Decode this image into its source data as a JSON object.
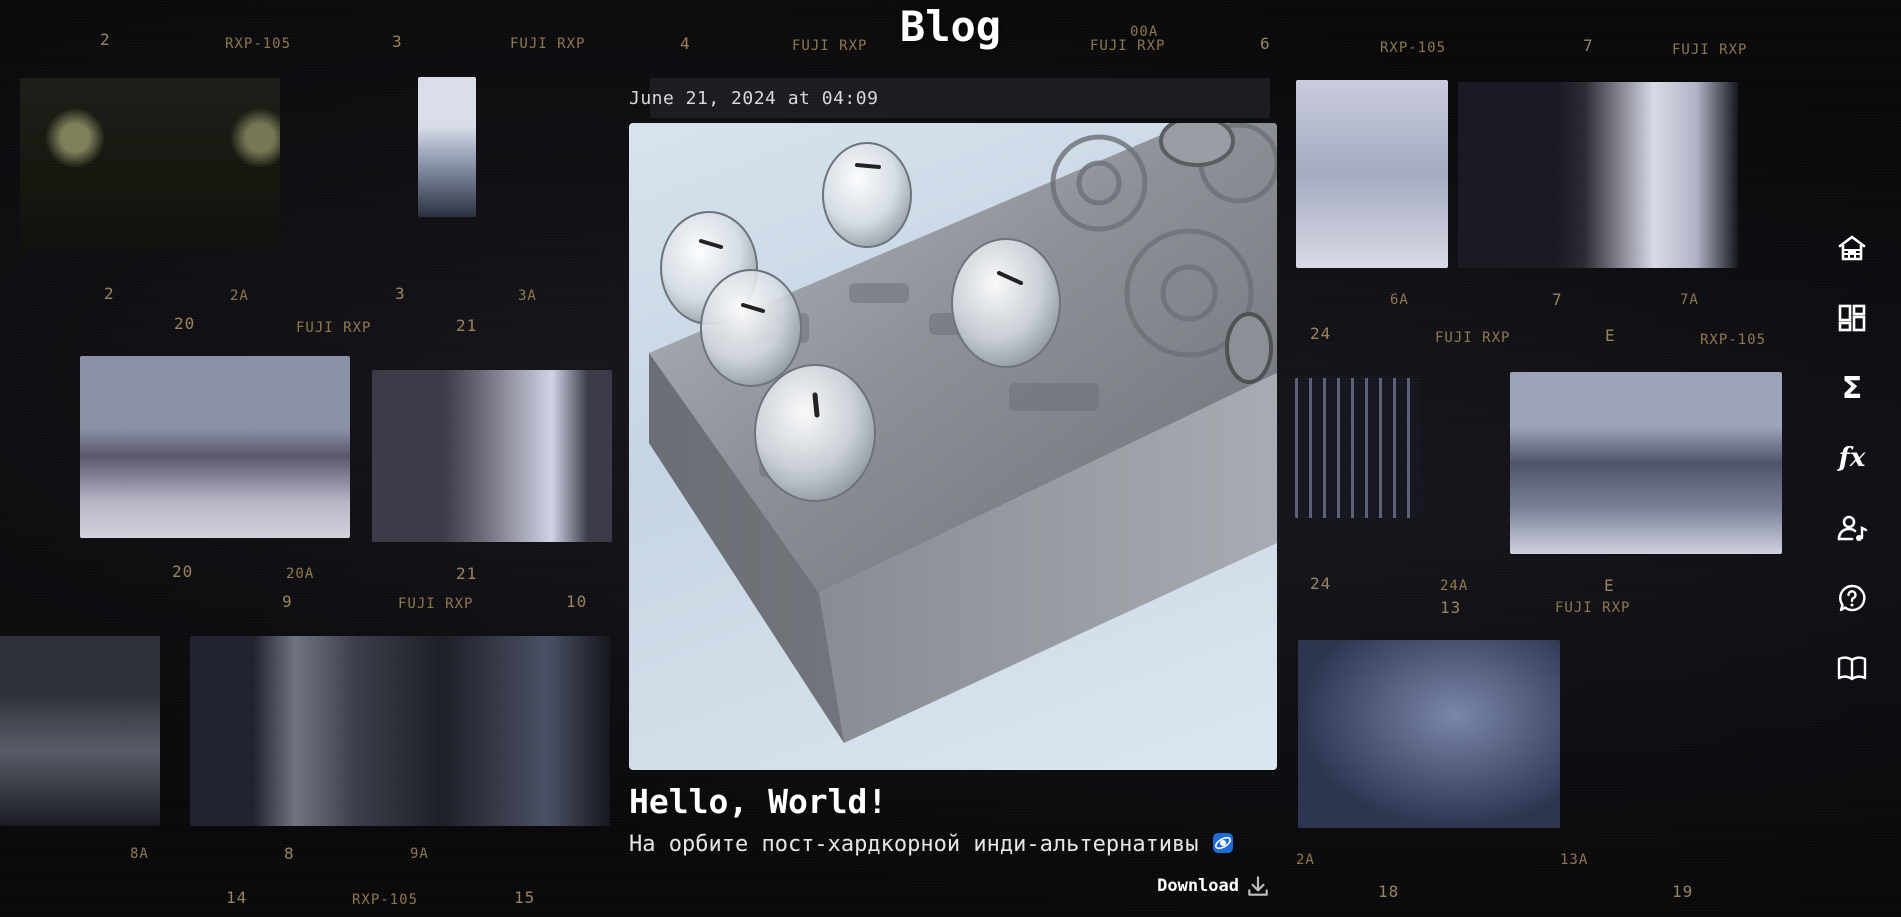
{
  "header": {
    "title": "Blog"
  },
  "post": {
    "date": "June 21, 2024 at 04:09",
    "title": "Hello, World!",
    "subtitle": "На орбите пост-хардкорной инди-альтернативы",
    "download_label": "Download"
  },
  "background_labels": {
    "row1": [
      "2",
      "RXP-105",
      "3",
      "FUJI RXP",
      "4",
      "FUJI RXP",
      "00A",
      "FUJI RXP",
      "6",
      "RXP-105",
      "7",
      "FUJI RXP"
    ],
    "row2": [
      "2",
      "2A",
      "3",
      "3A",
      "6A",
      "7",
      "7A"
    ],
    "row3": [
      "20",
      "FUJI RXP",
      "21",
      "24",
      "FUJI RXP",
      "E",
      "RXP-105"
    ],
    "row4": [
      "20",
      "20A",
      "21",
      "24",
      "24A",
      "E"
    ],
    "row5": [
      "9",
      "FUJI RXP",
      "10",
      "13",
      "FUJI RXP"
    ],
    "row6": [
      "8A",
      "8",
      "9A",
      "2A",
      "18",
      "13A",
      "19"
    ],
    "row7": [
      "14",
      "RXP-105",
      "15"
    ]
  },
  "side_nav": [
    {
      "icon": "home-icon"
    },
    {
      "icon": "dashboard-icon"
    },
    {
      "icon": "sigma-icon",
      "glyph": "Σ"
    },
    {
      "icon": "function-icon",
      "glyph": "fx"
    },
    {
      "icon": "user-music-icon"
    },
    {
      "icon": "help-icon"
    },
    {
      "icon": "book-icon"
    }
  ],
  "colors": {
    "background": "#09090b",
    "text": "#ffffff",
    "film_label": "#a68a57"
  }
}
